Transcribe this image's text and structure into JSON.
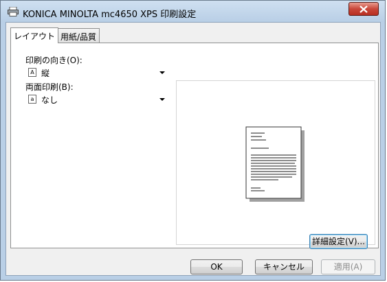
{
  "window": {
    "title": "KONICA MINOLTA mc4650 XPS 印刷設定",
    "icon": "printer-icon",
    "close_icon": "close-icon"
  },
  "tabs": [
    {
      "label": "レイアウト",
      "active": true
    },
    {
      "label": "用紙/品質",
      "active": false
    }
  ],
  "layout": {
    "orientation": {
      "label": "印刷の向き(O):",
      "value": "縦",
      "icon": "portrait-page-icon"
    },
    "duplex": {
      "label": "両面印刷(B):",
      "value": "なし",
      "icon": "simplex-page-icon"
    },
    "advanced_button": "詳細設定(V)..."
  },
  "footer": {
    "ok": "OK",
    "cancel": "キャンセル",
    "apply": "適用(A)"
  },
  "colors": {
    "title_gradient_top": "#cfe0f1",
    "close_red": "#c9473a"
  }
}
